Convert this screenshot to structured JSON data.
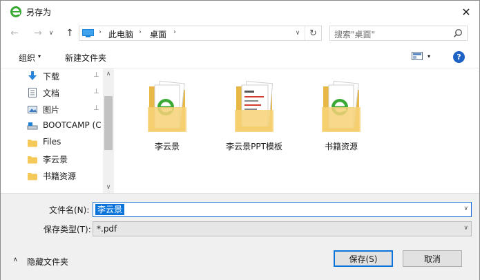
{
  "window": {
    "title": "另存为",
    "close_glyph": "✕"
  },
  "nav": {
    "back_glyph": "←",
    "forward_glyph": "→",
    "recent_glyph": "∨",
    "up_glyph": "↑"
  },
  "address": {
    "crumbs": [
      "此电脑",
      "桌面"
    ],
    "separator": "›",
    "dropdown_glyph": "∨",
    "refresh_glyph": "↻"
  },
  "search": {
    "placeholder": "搜索\"桌面\""
  },
  "toolbar": {
    "organize_label": "组织",
    "organize_caret": "▾",
    "new_folder_label": "新建文件夹",
    "view_caret": "▾",
    "help_label": "?"
  },
  "nav_pane": {
    "pin_glyph": "⊥",
    "items": [
      {
        "label": "下载",
        "icon": "download-icon",
        "pinned": true
      },
      {
        "label": "文档",
        "icon": "document-icon",
        "pinned": true
      },
      {
        "label": "图片",
        "icon": "picture-icon",
        "pinned": true
      },
      {
        "label": "BOOTCAMP (C",
        "icon": "drive-icon",
        "pinned": false
      },
      {
        "label": "Files",
        "icon": "folder-icon",
        "pinned": false
      },
      {
        "label": "李云景",
        "icon": "folder-icon",
        "pinned": false
      },
      {
        "label": "书籍资源",
        "icon": "folder-icon",
        "pinned": false
      }
    ],
    "scroll_up": "∧",
    "scroll_down": "∨"
  },
  "files": [
    {
      "name": "李云景",
      "icon": "folder-with-doc-icon"
    },
    {
      "name": "李云景PPT模板",
      "icon": "folder-with-slides-icon"
    },
    {
      "name": "书籍资源",
      "icon": "folder-with-doc-icon"
    }
  ],
  "form": {
    "filename_label": "文件名(N):",
    "filename_value": "李云景",
    "filetype_label": "保存类型(T):",
    "filetype_value": "*.pdf",
    "combo_arrow": "∨"
  },
  "footer": {
    "hide_folders_label": "隐藏文件夹",
    "hide_caret": "∧",
    "save_label": "保存(S)",
    "cancel_label": "取消"
  },
  "colors": {
    "accent": "#0a74da",
    "folder": "#f5c85a",
    "logo_green": "#3aa935"
  }
}
